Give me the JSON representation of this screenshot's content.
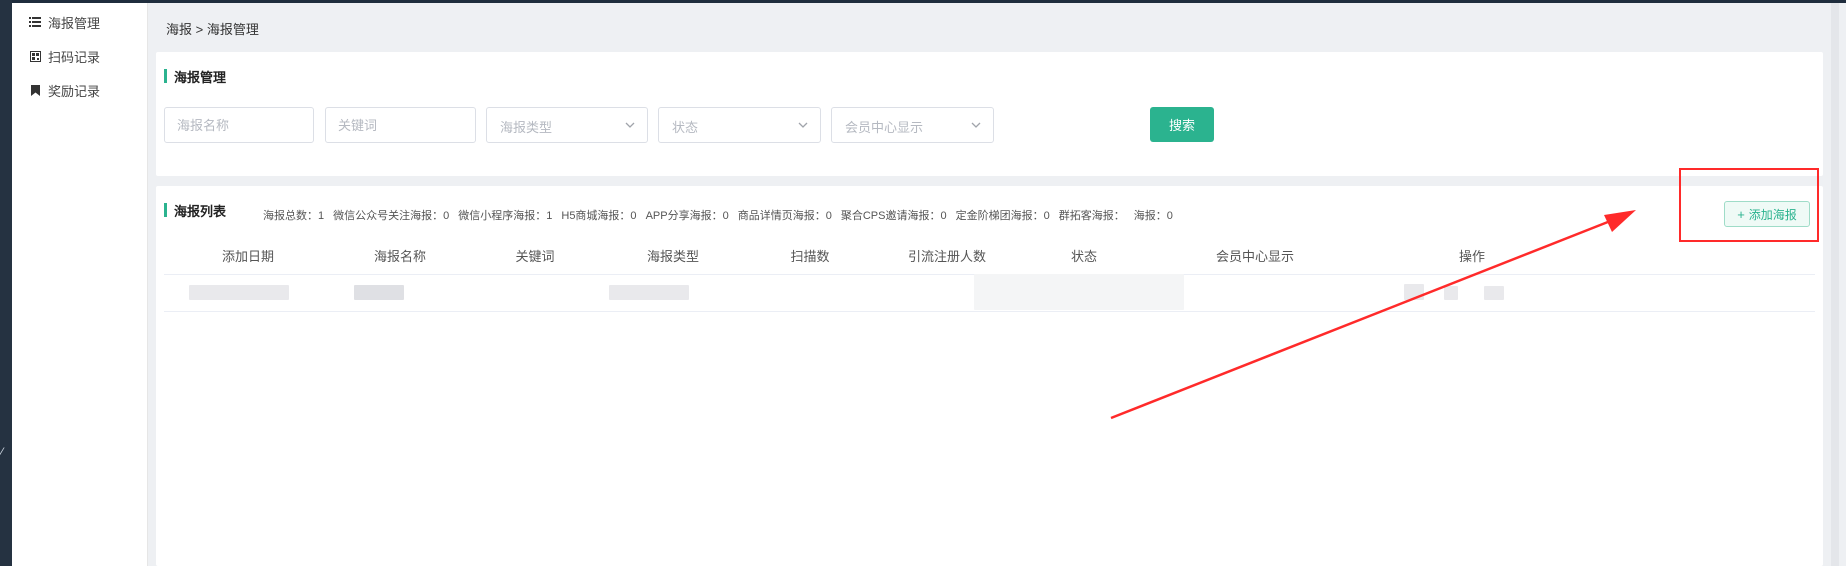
{
  "sidebar": {
    "items": [
      {
        "label": "海报管理",
        "icon": "list-icon"
      },
      {
        "label": "扫码记录",
        "icon": "qrcode-icon"
      },
      {
        "label": "奖励记录",
        "icon": "bookmark-icon"
      }
    ]
  },
  "breadcrumb": {
    "parent": "海报",
    "separator": " > ",
    "current": "海报管理"
  },
  "filter": {
    "title": "海报管理",
    "poster_name_placeholder": "海报名称",
    "keyword_placeholder": "关键词",
    "poster_type_placeholder": "海报类型",
    "status_placeholder": "状态",
    "member_display_placeholder": "会员中心显示",
    "search_label": "搜索"
  },
  "list": {
    "title": "海报列表",
    "stats": [
      "海报总数：1",
      "微信公众号关注海报：0",
      "微信小程序海报：1",
      "H5商城海报：0",
      "APP分享海报：0",
      "商品详情页海报：0",
      "聚合CPS邀请海报：0",
      "定金阶梯团海报：0",
      "群拓客海报：",
      "海报：0"
    ],
    "add_label": "添加海报",
    "columns": [
      "添加日期",
      "海报名称",
      "关键词",
      "海报类型",
      "扫描数",
      "引流注册人数",
      "状态",
      "会员中心显示",
      "操作"
    ]
  },
  "colors": {
    "accent": "#2bb38f",
    "annotation": "#ff2a2a"
  }
}
